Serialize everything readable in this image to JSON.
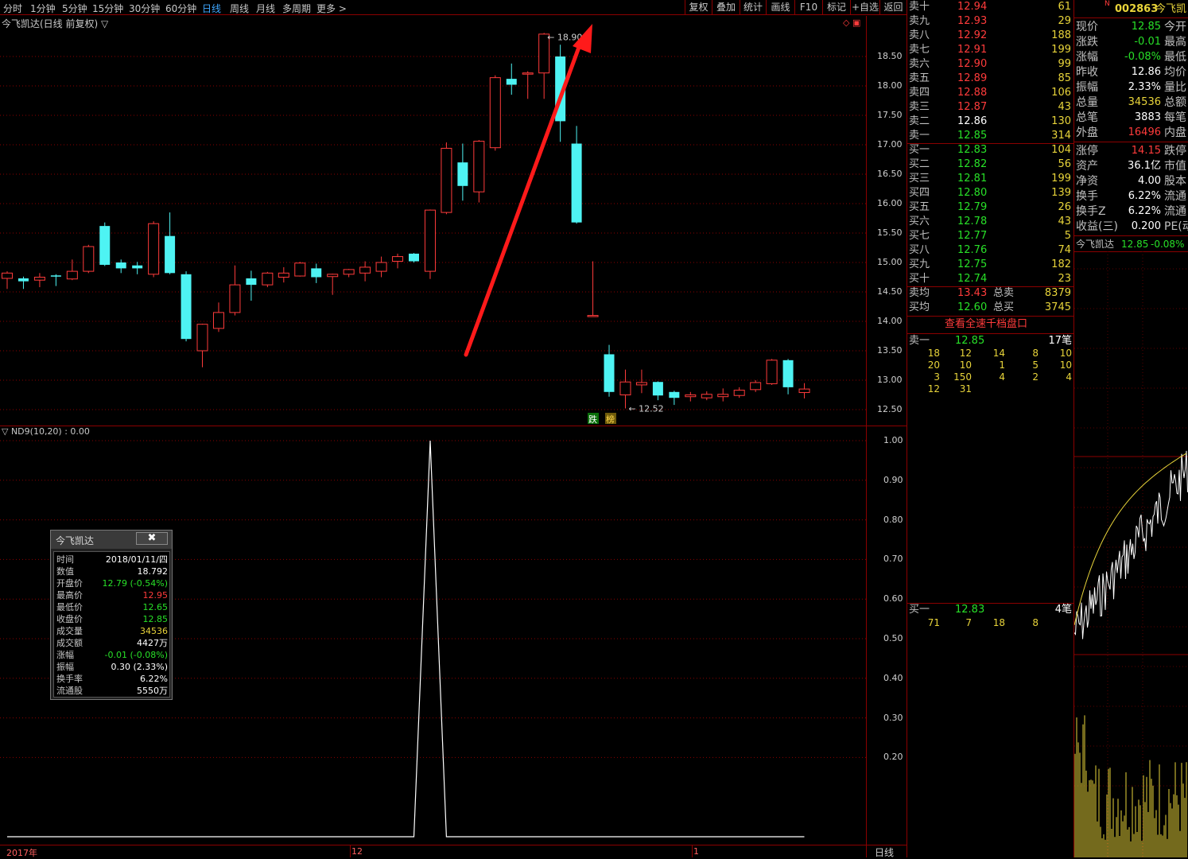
{
  "toolbar": {
    "periods": [
      "分时",
      "1分钟",
      "5分钟",
      "15分钟",
      "30分钟",
      "60分钟",
      "日线",
      "周线",
      "月线",
      "多周期",
      "更多 >"
    ],
    "active_period": "日线",
    "right_buttons": [
      "复权",
      "叠加",
      "统计",
      "画线",
      "F10",
      "标记",
      "+自选",
      "返回"
    ]
  },
  "chart": {
    "title": "今飞凯达(日线 前复权) ▽",
    "y_ticks": [
      "18.50",
      "18.00",
      "17.50",
      "17.00",
      "16.50",
      "16.00",
      "15.50",
      "15.00",
      "14.50",
      "14.00",
      "13.50",
      "13.00",
      "12.50"
    ],
    "high_label": "18.90",
    "low_label": "12.52",
    "badge_fall": "跌",
    "badge_rank": "榜",
    "corner_icons": "◇ ▣"
  },
  "indicator": {
    "title": "▽ ND9(10,20) : 0.00",
    "y_ticks": [
      "1.00",
      "0.90",
      "0.80",
      "0.70",
      "0.60",
      "0.50",
      "0.40",
      "0.30",
      "0.20"
    ]
  },
  "xaxis": {
    "labels": [
      "2017年",
      "12",
      "1"
    ],
    "period_label": "日线"
  },
  "chart_data": {
    "type": "candlestick",
    "candles": [
      {
        "o": 14.73,
        "c": 14.82,
        "h": 14.85,
        "l": 14.55
      },
      {
        "o": 14.73,
        "c": 14.68,
        "h": 14.76,
        "l": 14.55
      },
      {
        "o": 14.7,
        "c": 14.75,
        "h": 14.82,
        "l": 14.58
      },
      {
        "o": 14.78,
        "c": 14.76,
        "h": 14.8,
        "l": 14.6
      },
      {
        "o": 14.72,
        "c": 14.85,
        "h": 15.05,
        "l": 14.7
      },
      {
        "o": 14.85,
        "c": 15.27,
        "h": 15.3,
        "l": 14.82
      },
      {
        "o": 15.62,
        "c": 14.96,
        "h": 15.68,
        "l": 14.94
      },
      {
        "o": 15.0,
        "c": 14.9,
        "h": 15.05,
        "l": 14.82
      },
      {
        "o": 14.95,
        "c": 14.9,
        "h": 15.01,
        "l": 14.8
      },
      {
        "o": 14.8,
        "c": 15.66,
        "h": 15.7,
        "l": 14.75
      },
      {
        "o": 15.45,
        "c": 14.82,
        "h": 15.85,
        "l": 14.8
      },
      {
        "o": 14.8,
        "c": 13.7,
        "h": 14.85,
        "l": 13.66
      },
      {
        "o": 13.5,
        "c": 13.95,
        "h": 13.96,
        "l": 13.22
      },
      {
        "o": 13.88,
        "c": 14.15,
        "h": 14.32,
        "l": 13.82
      },
      {
        "o": 14.15,
        "c": 14.62,
        "h": 14.95,
        "l": 14.1
      },
      {
        "o": 14.73,
        "c": 14.62,
        "h": 14.86,
        "l": 14.35
      },
      {
        "o": 14.62,
        "c": 14.82,
        "h": 14.84,
        "l": 14.58
      },
      {
        "o": 14.75,
        "c": 14.82,
        "h": 14.92,
        "l": 14.66
      },
      {
        "o": 14.77,
        "c": 14.99,
        "h": 15.01,
        "l": 14.76
      },
      {
        "o": 14.9,
        "c": 14.75,
        "h": 14.98,
        "l": 14.65
      },
      {
        "o": 14.76,
        "c": 14.8,
        "h": 14.81,
        "l": 14.45
      },
      {
        "o": 14.8,
        "c": 14.88,
        "h": 14.89,
        "l": 14.75
      },
      {
        "o": 14.82,
        "c": 14.92,
        "h": 15.02,
        "l": 14.68
      },
      {
        "o": 14.85,
        "c": 15.0,
        "h": 15.1,
        "l": 14.75
      },
      {
        "o": 15.02,
        "c": 15.1,
        "h": 15.15,
        "l": 14.9
      },
      {
        "o": 15.15,
        "c": 15.02,
        "h": 15.16,
        "l": 15.0
      },
      {
        "o": 14.85,
        "c": 15.89,
        "h": 15.9,
        "l": 14.72
      },
      {
        "o": 15.85,
        "c": 16.94,
        "h": 17.04,
        "l": 15.82
      },
      {
        "o": 16.7,
        "c": 16.3,
        "h": 17.02,
        "l": 16.05
      },
      {
        "o": 16.2,
        "c": 17.06,
        "h": 17.08,
        "l": 16.02
      },
      {
        "o": 16.95,
        "c": 18.14,
        "h": 18.18,
        "l": 16.9
      },
      {
        "o": 18.12,
        "c": 18.02,
        "h": 18.38,
        "l": 17.85
      },
      {
        "o": 18.2,
        "c": 18.22,
        "h": 18.25,
        "l": 17.78
      },
      {
        "o": 18.22,
        "c": 18.88,
        "h": 18.9,
        "l": 17.78
      },
      {
        "o": 18.5,
        "c": 17.4,
        "h": 18.7,
        "l": 17.05
      },
      {
        "o": 17.02,
        "c": 15.68,
        "h": 17.32,
        "l": 15.66
      },
      {
        "o": 14.1,
        "c": 14.1,
        "h": 15.02,
        "l": 14.1
      },
      {
        "o": 13.44,
        "c": 12.8,
        "h": 13.6,
        "l": 12.72
      },
      {
        "o": 12.75,
        "c": 12.97,
        "h": 13.18,
        "l": 12.52
      },
      {
        "o": 12.92,
        "c": 12.96,
        "h": 13.18,
        "l": 12.78
      },
      {
        "o": 12.97,
        "c": 12.74,
        "h": 12.98,
        "l": 12.66
      },
      {
        "o": 12.8,
        "c": 12.7,
        "h": 12.82,
        "l": 12.58
      },
      {
        "o": 12.72,
        "c": 12.75,
        "h": 12.8,
        "l": 12.64
      },
      {
        "o": 12.7,
        "c": 12.76,
        "h": 12.81,
        "l": 12.66
      },
      {
        "o": 12.72,
        "c": 12.76,
        "h": 12.86,
        "l": 12.64
      },
      {
        "o": 12.74,
        "c": 12.83,
        "h": 12.88,
        "l": 12.7
      },
      {
        "o": 12.84,
        "c": 12.96,
        "h": 13.0,
        "l": 12.8
      },
      {
        "o": 12.94,
        "c": 13.34,
        "h": 13.36,
        "l": 12.92
      },
      {
        "o": 13.34,
        "c": 12.88,
        "h": 13.36,
        "l": 12.76
      },
      {
        "o": 12.79,
        "c": 12.85,
        "h": 12.95,
        "l": 12.69
      }
    ],
    "ylim": [
      12.3,
      19.0
    ],
    "indicator_series": {
      "name": "ND9(10,20)",
      "peak_index": 26,
      "peak_value": 1.0,
      "base_value": 0.0,
      "ylim": [
        0,
        1.05
      ]
    }
  },
  "quote": {
    "asks": [
      {
        "label": "卖十",
        "price": "12.94",
        "vol": "61"
      },
      {
        "label": "卖九",
        "price": "12.93",
        "vol": "29"
      },
      {
        "label": "卖八",
        "price": "12.92",
        "vol": "188"
      },
      {
        "label": "卖七",
        "price": "12.91",
        "vol": "199"
      },
      {
        "label": "卖六",
        "price": "12.90",
        "vol": "99"
      },
      {
        "label": "卖五",
        "price": "12.89",
        "vol": "85"
      },
      {
        "label": "卖四",
        "price": "12.88",
        "vol": "106"
      },
      {
        "label": "卖三",
        "price": "12.87",
        "vol": "43"
      },
      {
        "label": "卖二",
        "price": "12.86",
        "vol": "130"
      },
      {
        "label": "卖一",
        "price": "12.85",
        "vol": "314"
      }
    ],
    "bids": [
      {
        "label": "买一",
        "price": "12.83",
        "vol": "104"
      },
      {
        "label": "买二",
        "price": "12.82",
        "vol": "56"
      },
      {
        "label": "买三",
        "price": "12.81",
        "vol": "199"
      },
      {
        "label": "买四",
        "price": "12.80",
        "vol": "139"
      },
      {
        "label": "买五",
        "price": "12.79",
        "vol": "26"
      },
      {
        "label": "买六",
        "price": "12.78",
        "vol": "43"
      },
      {
        "label": "买七",
        "price": "12.77",
        "vol": "5"
      },
      {
        "label": "买八",
        "price": "12.76",
        "vol": "74"
      },
      {
        "label": "买九",
        "price": "12.75",
        "vol": "182"
      },
      {
        "label": "买十",
        "price": "12.74",
        "vol": "23"
      }
    ],
    "avg_sell": {
      "label": "卖均",
      "price": "13.43",
      "tlabel": "总卖",
      "vol": "8379"
    },
    "avg_buy": {
      "label": "买均",
      "price": "12.60",
      "tlabel": "总买",
      "vol": "3745"
    },
    "depth_link": "查看全速千档盘口",
    "sell1_queue": {
      "label": "卖一",
      "price": "12.85",
      "count": "17笔",
      "rows": [
        [
          "18",
          "12",
          "14",
          "8",
          "10"
        ],
        [
          "20",
          "10",
          "1",
          "5",
          "10"
        ],
        [
          "3",
          "150",
          "4",
          "2",
          "4"
        ],
        [
          "12",
          "31",
          "",
          "",
          ""
        ]
      ]
    },
    "buy1_queue": {
      "label": "买一",
      "price": "12.83",
      "count": "4笔",
      "rows": [
        [
          "71",
          "7",
          "18",
          "8",
          ""
        ]
      ]
    }
  },
  "stats": {
    "code_prefix": "N",
    "code": "002863",
    "name_short": "今飞凯",
    "rows": [
      {
        "k": "现价",
        "v": "12.85",
        "c": "dn",
        "k2": "今开"
      },
      {
        "k": "涨跌",
        "v": "-0.01",
        "c": "dn",
        "k2": "最高"
      },
      {
        "k": "涨幅",
        "v": "-0.08%",
        "c": "dn",
        "k2": "最低"
      },
      {
        "k": "昨收",
        "v": "12.86",
        "c": "wh",
        "k2": "均价"
      },
      {
        "k": "振幅",
        "v": "2.33%",
        "c": "wh",
        "k2": "量比"
      },
      {
        "k": "总量",
        "v": "34536",
        "c": "yl",
        "k2": "总额"
      },
      {
        "k": "总笔",
        "v": "3883",
        "c": "wh",
        "k2": "每笔"
      },
      {
        "k": "外盘",
        "v": "16496",
        "c": "up",
        "k2": "内盘"
      },
      {
        "k": "涨停",
        "v": "14.15",
        "c": "up",
        "k2": "跌停"
      },
      {
        "k": "资产",
        "v": "36.1亿",
        "c": "wh",
        "k2": "市值"
      },
      {
        "k": "净资",
        "v": "4.00",
        "c": "wh",
        "k2": "股本"
      },
      {
        "k": "换手",
        "v": "6.22%",
        "c": "wh",
        "k2": "流通"
      },
      {
        "k": "换手Z",
        "v": "6.22%",
        "c": "wh",
        "k2": "流通"
      },
      {
        "k": "收益(三)",
        "v": "0.200",
        "c": "wh",
        "k2": "PE(动"
      }
    ],
    "mini_title": "今飞凯达",
    "mini_price": "12.85",
    "mini_change": "-0.08%"
  },
  "infobox": {
    "title": "今飞凯达",
    "close_glyph": "✖",
    "rows": [
      {
        "k": "时间",
        "v": "2018/01/11/四",
        "c": "wh"
      },
      {
        "k": "数值",
        "v": "18.792",
        "c": "wh"
      },
      {
        "k": "开盘价",
        "v": "12.79 (-0.54%)",
        "c": "dn"
      },
      {
        "k": "最高价",
        "v": "12.95",
        "c": "up"
      },
      {
        "k": "最低价",
        "v": "12.65",
        "c": "dn"
      },
      {
        "k": "收盘价",
        "v": "12.85",
        "c": "dn"
      },
      {
        "k": "成交量",
        "v": "34536",
        "c": "yl"
      },
      {
        "k": "成交额",
        "v": "4427万",
        "c": "wh"
      },
      {
        "k": "涨幅",
        "v": "-0.01 (-0.08%)",
        "c": "dn"
      },
      {
        "k": "振幅",
        "v": "0.30 (2.33%)",
        "c": "wh"
      },
      {
        "k": "换手率",
        "v": "6.22%",
        "c": "wh"
      },
      {
        "k": "流通股",
        "v": "5550万",
        "c": "wh"
      }
    ]
  },
  "colors": {
    "up": "#ff3b3b",
    "down": "#4ef3f3",
    "grid": "#8b0000",
    "arrow": "#ff1a1a",
    "yellow": "#e8d43a"
  }
}
